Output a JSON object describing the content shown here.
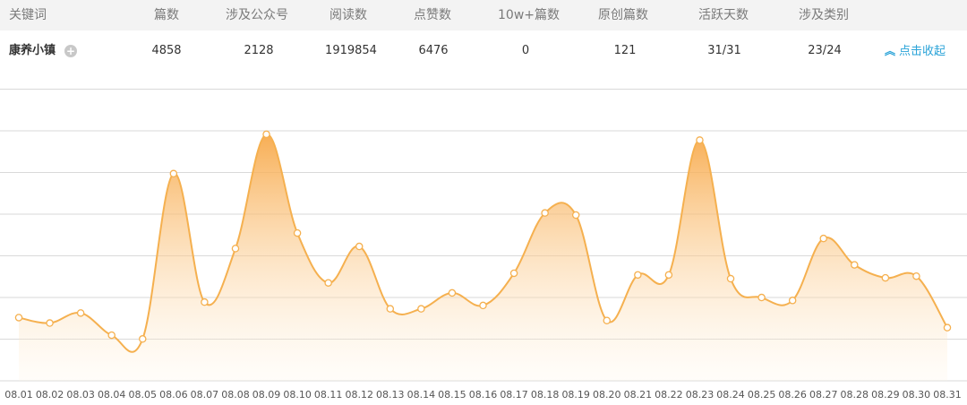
{
  "table": {
    "headers": [
      "关键词",
      "篇数",
      "涉及公众号",
      "阅读数",
      "点赞数",
      "10w+篇数",
      "原创篇数",
      "活跃天数",
      "涉及类别"
    ],
    "row": {
      "keyword": "康养小镇",
      "articles": "4858",
      "accounts": "2128",
      "reads": "1919854",
      "likes": "6476",
      "over100k": "0",
      "original": "121",
      "active_days": "31/31",
      "categories": "23/24"
    },
    "collapse_label": "点击收起",
    "collapse_icon": "double-chevron-up-icon",
    "expand_icon": "plus-circle-icon"
  },
  "chart_data": {
    "type": "area",
    "x": [
      "08.01",
      "08.02",
      "08.03",
      "08.04",
      "08.05",
      "08.06",
      "08.07",
      "08.08",
      "08.09",
      "08.10",
      "08.11",
      "08.12",
      "08.13",
      "08.14",
      "08.15",
      "08.16",
      "08.17",
      "08.18",
      "08.19",
      "08.20",
      "08.21",
      "08.22",
      "08.23",
      "08.24",
      "08.25",
      "08.26",
      "08.27",
      "08.28",
      "08.29",
      "08.30",
      "08.31"
    ],
    "series": [
      {
        "values": [
          1.51,
          1.38,
          1.62,
          1.09,
          1.0,
          4.95,
          1.88,
          3.16,
          5.89,
          3.53,
          2.34,
          3.21,
          1.72,
          1.72,
          2.1,
          1.8,
          2.57,
          4.01,
          3.96,
          1.44,
          2.53,
          2.53,
          5.75,
          2.44,
          1.99,
          1.92,
          3.4,
          2.77,
          2.46,
          2.5,
          1.27
        ]
      }
    ],
    "y_unit_note": "",
    "grid": true,
    "colors": {
      "line": "#f5b04f",
      "fill_top": "#f7a541",
      "fill_bottom": "#fff4e3",
      "point_fill": "#ffffff",
      "grid": "#d9d9d9",
      "header_bg": "#f3f3f3",
      "link": "#2aa3d8"
    }
  }
}
